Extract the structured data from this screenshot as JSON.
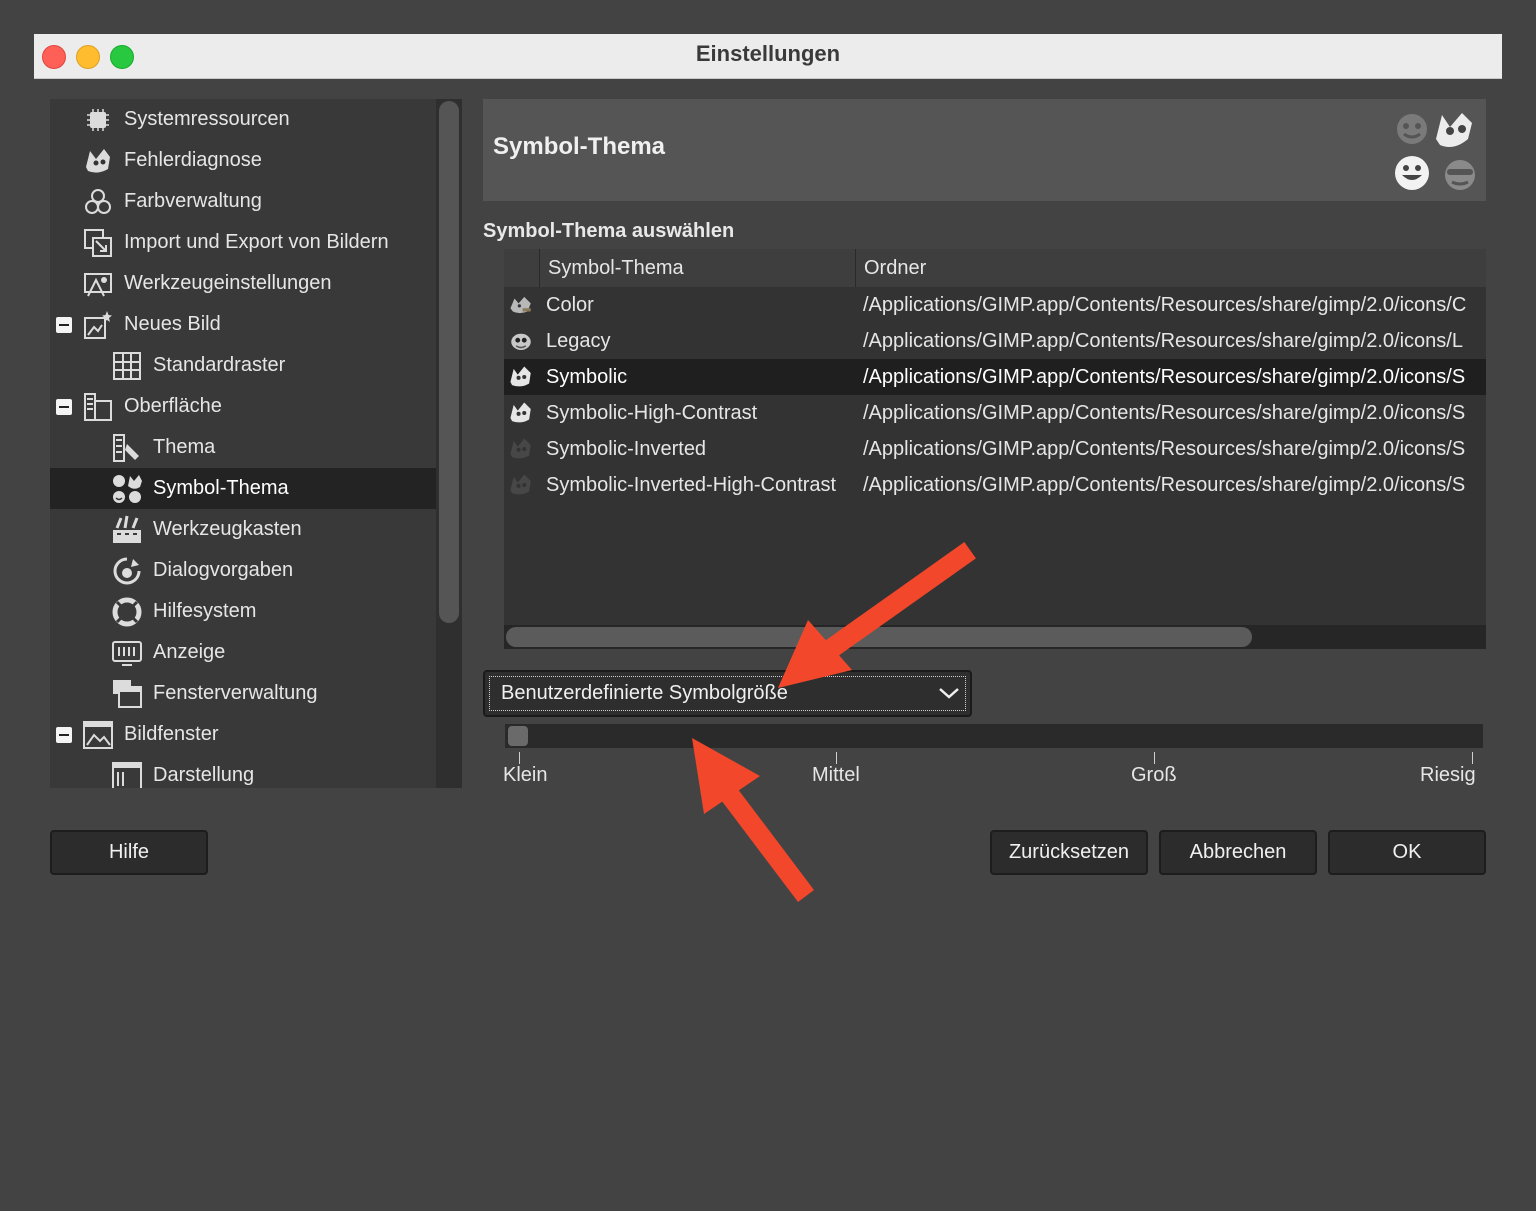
{
  "window": {
    "title": "Einstellungen"
  },
  "tree": {
    "items": [
      {
        "label": "Systemressourcen",
        "icon": "chip-icon",
        "level": 0,
        "expander": false
      },
      {
        "label": "Fehlerdiagnose",
        "icon": "wilber-debug-icon",
        "level": 0,
        "expander": false
      },
      {
        "label": "Farbverwaltung",
        "icon": "color-circles-icon",
        "level": 0,
        "expander": false
      },
      {
        "label": "Import und Export von Bildern",
        "icon": "import-export-icon",
        "level": 0,
        "expander": false
      },
      {
        "label": "Werkzeugeinstellungen",
        "icon": "tool-options-icon",
        "level": 0,
        "expander": false
      },
      {
        "label": "Neues Bild",
        "icon": "new-image-icon",
        "level": 0,
        "expander": true
      },
      {
        "label": "Standardraster",
        "icon": "grid-icon",
        "level": 1,
        "expander": false
      },
      {
        "label": "Oberfläche",
        "icon": "interface-icon",
        "level": 0,
        "expander": true
      },
      {
        "label": "Thema",
        "icon": "theme-icon",
        "level": 1,
        "expander": false
      },
      {
        "label": "Symbol-Thema",
        "icon": "icon-theme-icon",
        "level": 1,
        "expander": false,
        "selected": true
      },
      {
        "label": "Werkzeugkasten",
        "icon": "toolbox-icon",
        "level": 1,
        "expander": false
      },
      {
        "label": "Dialogvorgaben",
        "icon": "dialog-defaults-icon",
        "level": 1,
        "expander": false
      },
      {
        "label": "Hilfesystem",
        "icon": "lifebuoy-icon",
        "level": 1,
        "expander": false
      },
      {
        "label": "Anzeige",
        "icon": "display-icon",
        "level": 1,
        "expander": false
      },
      {
        "label": "Fensterverwaltung",
        "icon": "window-management-icon",
        "level": 1,
        "expander": false
      },
      {
        "label": "Bildfenster",
        "icon": "image-window-icon",
        "level": 0,
        "expander": true
      },
      {
        "label": "Darstellung",
        "icon": "appearance-icon",
        "level": 1,
        "expander": false
      }
    ]
  },
  "header": {
    "title": "Symbol-Thema"
  },
  "section": {
    "label": "Symbol-Thema auswählen"
  },
  "table": {
    "columns": [
      "Symbol-Thema",
      "Ordner"
    ],
    "rows": [
      {
        "name": "Color",
        "folder": "/Applications/GIMP.app/Contents/Resources/share/gimp/2.0/icons/C",
        "icon": "wilber-color-icon"
      },
      {
        "name": "Legacy",
        "folder": "/Applications/GIMP.app/Contents/Resources/share/gimp/2.0/icons/L",
        "icon": "wilber-legacy-icon"
      },
      {
        "name": "Symbolic",
        "folder": "/Applications/GIMP.app/Contents/Resources/share/gimp/2.0/icons/S",
        "icon": "wilber-symbolic-icon",
        "selected": true
      },
      {
        "name": "Symbolic-High-Contrast",
        "folder": "/Applications/GIMP.app/Contents/Resources/share/gimp/2.0/icons/S",
        "icon": "wilber-symbolic-icon"
      },
      {
        "name": "Symbolic-Inverted",
        "folder": "/Applications/GIMP.app/Contents/Resources/share/gimp/2.0/icons/S",
        "icon": "wilber-dark-icon"
      },
      {
        "name": "Symbolic-Inverted-High-Contrast",
        "folder": "/Applications/GIMP.app/Contents/Resources/share/gimp/2.0/icons/S",
        "icon": "wilber-dark-icon"
      }
    ]
  },
  "icon_size": {
    "dropdown_label": "Benutzerdefinierte Symbolgröße",
    "slider_value": 0,
    "ticks": [
      "Klein",
      "Mittel",
      "Groß",
      "Riesig"
    ]
  },
  "buttons": {
    "help": "Hilfe",
    "reset": "Zurücksetzen",
    "cancel": "Abbrechen",
    "ok": "OK"
  },
  "colors": {
    "annotation_arrow": "#f2472a",
    "selection": "#232323"
  }
}
